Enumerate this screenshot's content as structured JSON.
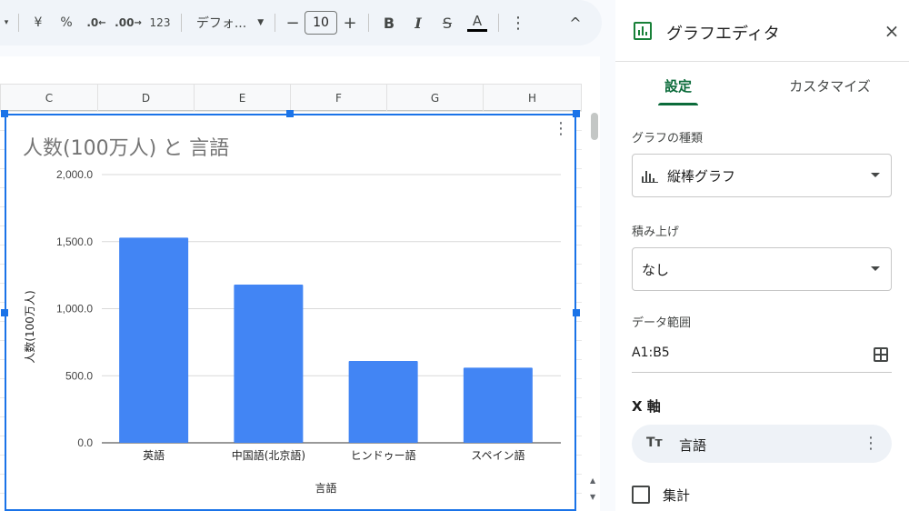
{
  "toolbar": {
    "currency": "¥",
    "percent": "%",
    "decimal_decrease": ".0",
    "decimal_increase": ".00",
    "number_format": "123",
    "font_name": "デフォ...",
    "minus": "−",
    "font_size": "10",
    "plus": "+",
    "bold": "B",
    "italic": "I",
    "strike": "S",
    "text_color": "A",
    "more": "⋮",
    "collapse": "^"
  },
  "sheet": {
    "columns": [
      "C",
      "D",
      "E",
      "F",
      "G",
      "H"
    ]
  },
  "chart_data": {
    "type": "bar",
    "title": "人数(100万人) と 言語",
    "xlabel": "言語",
    "ylabel": "人数(100万人)",
    "categories": [
      "英語",
      "中国語(北京語)",
      "ヒンドゥー語",
      "スペイン語"
    ],
    "values": [
      1530,
      1180,
      610,
      560
    ],
    "ylim": [
      0,
      2000
    ],
    "yticks": [
      "0.0",
      "500.0",
      "1,000.0",
      "1,500.0",
      "2,000.0"
    ],
    "bar_color": "#4285f4",
    "grid": true
  },
  "panel": {
    "title": "グラフエディタ",
    "close": "×",
    "tabs": [
      {
        "label": "設定",
        "active": true
      },
      {
        "label": "カスタマイズ",
        "active": false
      }
    ],
    "chart_type_label": "グラフの種類",
    "chart_type_value": "縦棒グラフ",
    "stacking_label": "積み上げ",
    "stacking_value": "なし",
    "range_label": "データ範囲",
    "range_value": "A1:B5",
    "x_axis_label": "X 軸",
    "x_axis_chip_icon": "Tт",
    "x_axis_chip_value": "言語",
    "chip_menu": "⋮",
    "aggregate_label": "集計"
  },
  "colors": {
    "accent": "#1a73e8",
    "tab_active": "#0b6b3a",
    "icon_green": "#188038"
  }
}
